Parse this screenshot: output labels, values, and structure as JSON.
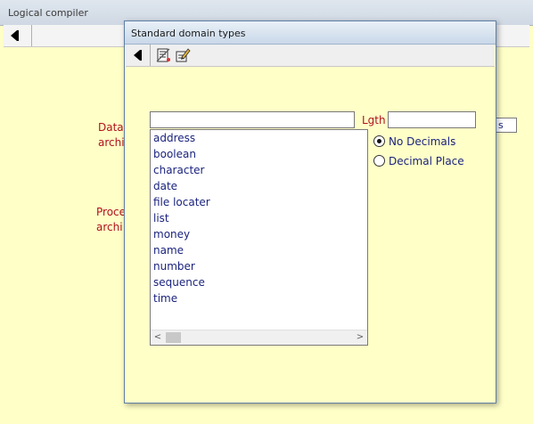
{
  "background_window": {
    "title": "Logical compiler",
    "labels": {
      "data_line1": "Data",
      "data_line2": "archi",
      "process_line1": "Proce",
      "process_line2": "archi"
    },
    "field_text": "s"
  },
  "dialog": {
    "title": "Standard domain types",
    "toolbar": {
      "back_icon": "back-arrow-icon",
      "list_icon": "list-document-icon",
      "edit_icon": "edit-pencil-icon"
    },
    "name_input_value": "",
    "length_label": "Lgth",
    "length_input_value": "",
    "domain_types": [
      "address",
      "boolean",
      "character",
      "date",
      "file locater",
      "list",
      "money",
      "name",
      "number",
      "sequence",
      "time"
    ],
    "decimal_options": [
      {
        "label": "No Decimals",
        "selected": true
      },
      {
        "label": "Decimal Place",
        "selected": false
      }
    ],
    "scrollbar": {
      "left_arrow": "<",
      "right_arrow": ">"
    }
  },
  "colors": {
    "background": "#ffffc8",
    "label_red": "#b0121c",
    "list_text": "#1a237e"
  }
}
